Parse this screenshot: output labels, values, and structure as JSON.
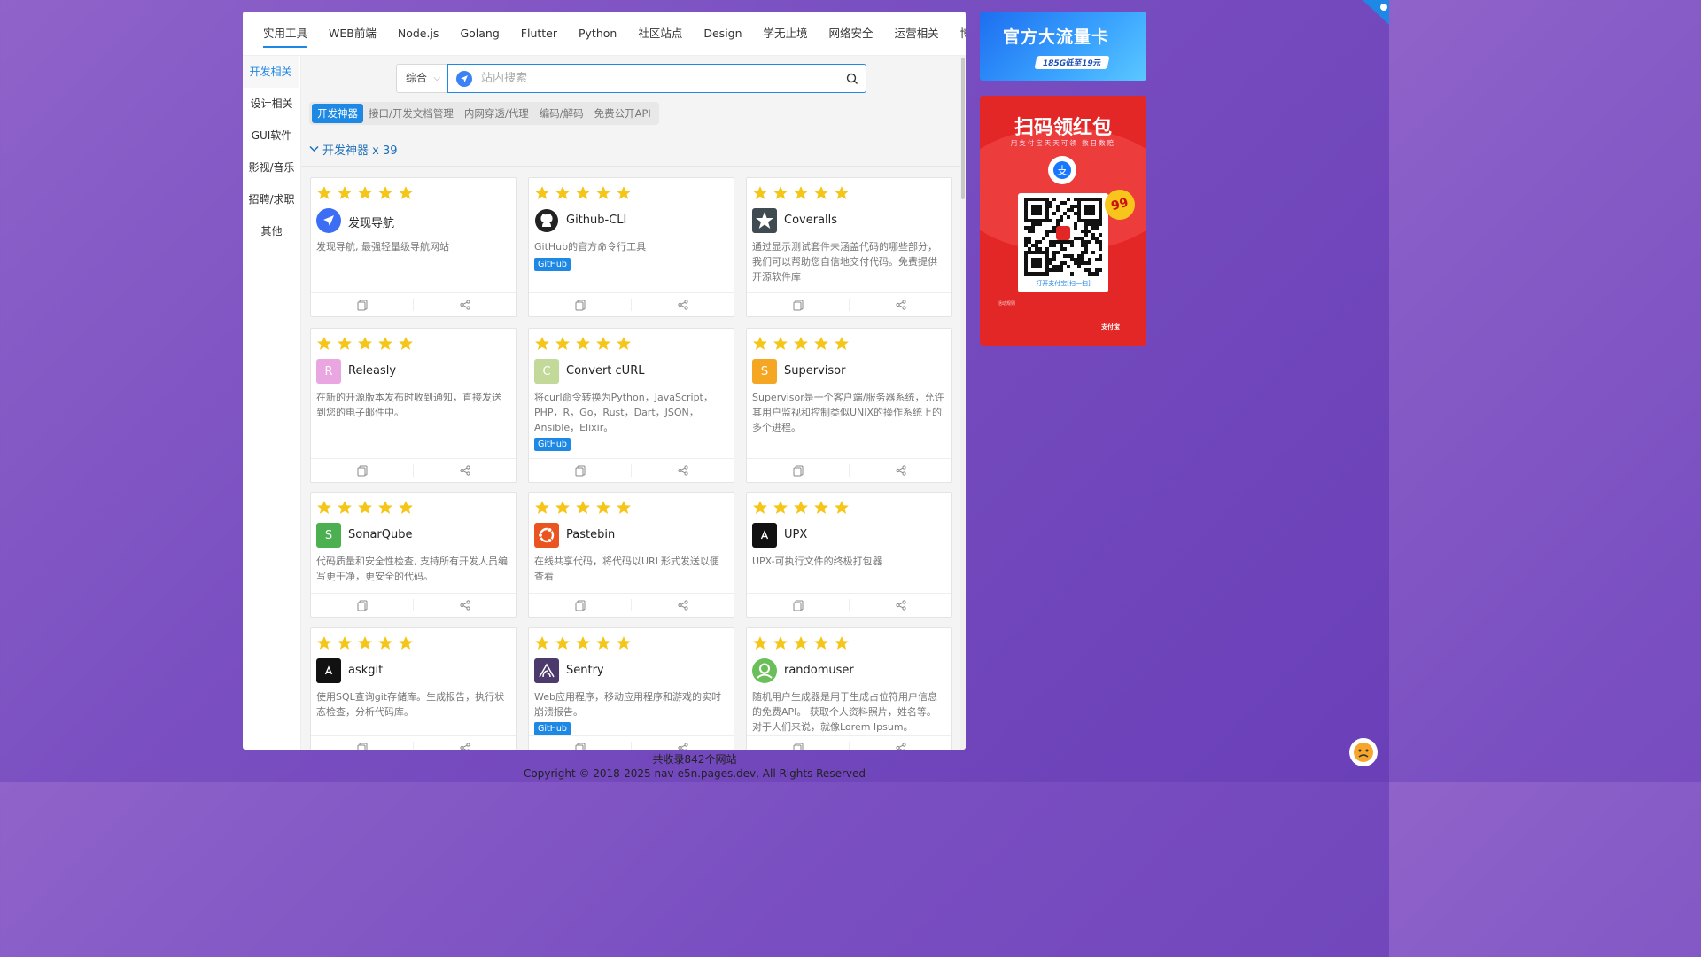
{
  "top_tabs": [
    "实用工具",
    "WEB前端",
    "Node.js",
    "Golang",
    "Flutter",
    "Python",
    "社区站点",
    "Design",
    "学无止境",
    "网络安全",
    "运营相关",
    "博客看点"
  ],
  "side_items": [
    "开发相关",
    "设计相关",
    "GUI软件",
    "影视/音乐",
    "招聘/求职",
    "其他"
  ],
  "search": {
    "scope": "综合",
    "placeholder": "站内搜索"
  },
  "sub_tabs": [
    "开发神器",
    "接口/开发文档管理",
    "内网穿透/代理",
    "编码/解码",
    "免费公开API"
  ],
  "section_title": "开发神器 x 39",
  "colors": {
    "accent": "#1e88e5",
    "star": "#f5c518",
    "tag": "#1e88e5"
  },
  "cards": [
    {
      "name": "发现导航",
      "desc": "发现导航, 最强轻量级导航网站",
      "tag": "",
      "logo": "nav-icon",
      "logo_color": "#3b6ef5",
      "letter": ""
    },
    {
      "name": "Github-CLI",
      "desc": "GitHub的官方命令行工具",
      "tag": "GitHub",
      "logo": "github-icon",
      "logo_color": "#222222",
      "letter": ""
    },
    {
      "name": "Coveralls",
      "desc": "通过显示测试套件未涵盖代码的哪些部分，我们可以帮助您自信地交付代码。免费提供开源软件库",
      "tag": "",
      "logo": "coveralls-icon",
      "logo_color": "#3f4b50",
      "letter": ""
    },
    {
      "name": "Releasly",
      "desc": "在新的开源版本发布时收到通知，直接发送到您的电子邮件中。",
      "tag": "",
      "logo": "letter-icon",
      "logo_color": "#e9a6e0",
      "letter": "R"
    },
    {
      "name": "Convert cURL",
      "desc": "将curl命令转换为Python，JavaScript，PHP，R，Go，Rust，Dart，JSON，Ansible，Elixir。",
      "tag": "GitHub",
      "logo": "letter-icon",
      "logo_color": "#c2d99a",
      "letter": "C"
    },
    {
      "name": "Supervisor",
      "desc": "Supervisor是一个客户端/服务器系统，允许其用户监视和控制类似UNIX的操作系统上的多个进程。",
      "tag": "",
      "logo": "letter-icon",
      "logo_color": "#f5a623",
      "letter": "S"
    },
    {
      "name": "SonarQube",
      "desc": "代码质量和安全性检查, 支持所有开发人员编写更干净，更安全的代码。",
      "tag": "",
      "logo": "letter-icon",
      "logo_color": "#4caf50",
      "letter": "S"
    },
    {
      "name": "Pastebin",
      "desc": "在线共享代码，将代码以URL形式发送以便查看",
      "tag": "",
      "logo": "ubuntu-icon",
      "logo_color": "#e95420",
      "letter": ""
    },
    {
      "name": "UPX",
      "desc": "UPX-可执行文件的终极打包器",
      "tag": "",
      "logo": "upx-icon",
      "logo_color": "#111111",
      "letter": "A"
    },
    {
      "name": "askgit",
      "desc": "使用SQL查询git存储库。生成报告，执行状态检查，分析代码库。",
      "tag": "",
      "logo": "askgit-icon",
      "logo_color": "#111111",
      "letter": "A"
    },
    {
      "name": "Sentry",
      "desc": "Web应用程序，移动应用程序和游戏的实时崩溃报告。",
      "tag": "GitHub",
      "logo": "sentry-icon",
      "logo_color": "#4b3a6b",
      "letter": ""
    },
    {
      "name": "randomuser",
      "desc": "随机用户生成器是用于生成占位符用户信息的免费API。 获取个人资料照片，姓名等。 对于人们来说，就像Lorem Ipsum。",
      "tag": "",
      "logo": "randomuser-icon",
      "logo_color": "#6bbf59",
      "letter": ""
    }
  ],
  "ads": {
    "top_banner": {
      "title": "官方大流量卡",
      "subtitle": "185G低至19元"
    },
    "redpacket": {
      "title": "扫码领红包",
      "subtitle": "用支付宝天天可领 数日数赔",
      "qr_caption": "打开支付宝[扫一扫]",
      "badge": "99",
      "rules_title": "活动规则",
      "brand": "支付宝"
    }
  },
  "footer": {
    "count": "共收录842个网站",
    "copyright": "Copyright © 2018-2025 nav-e5n.pages.dev, All Rights Reserved"
  }
}
